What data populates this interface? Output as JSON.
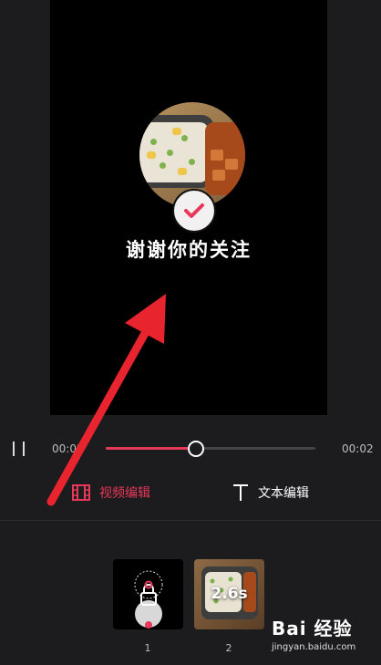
{
  "preview": {
    "caption": "谢谢你的关注"
  },
  "player": {
    "current_time": "00:02",
    "total_time": "00:02",
    "progress": 0.43
  },
  "tabs": [
    {
      "label": "视频编辑",
      "active": true,
      "icon": "film-icon",
      "color": "#e8385a"
    },
    {
      "label": "文本编辑",
      "active": false,
      "icon": "text-t-icon",
      "color": "#ffffff"
    }
  ],
  "timeline": {
    "clips": [
      {
        "index": "1",
        "thumbnail": "avatar-lock-frame"
      },
      {
        "index": "2",
        "thumbnail": "food-photo",
        "duration": "2.6s"
      }
    ]
  },
  "watermark": {
    "logo": "Bai 经验",
    "url": "jingyan.baidu.com"
  },
  "colors": {
    "accent": "#e8385a",
    "background": "#1c1c1e",
    "annotation_arrow": "#e8242f"
  }
}
